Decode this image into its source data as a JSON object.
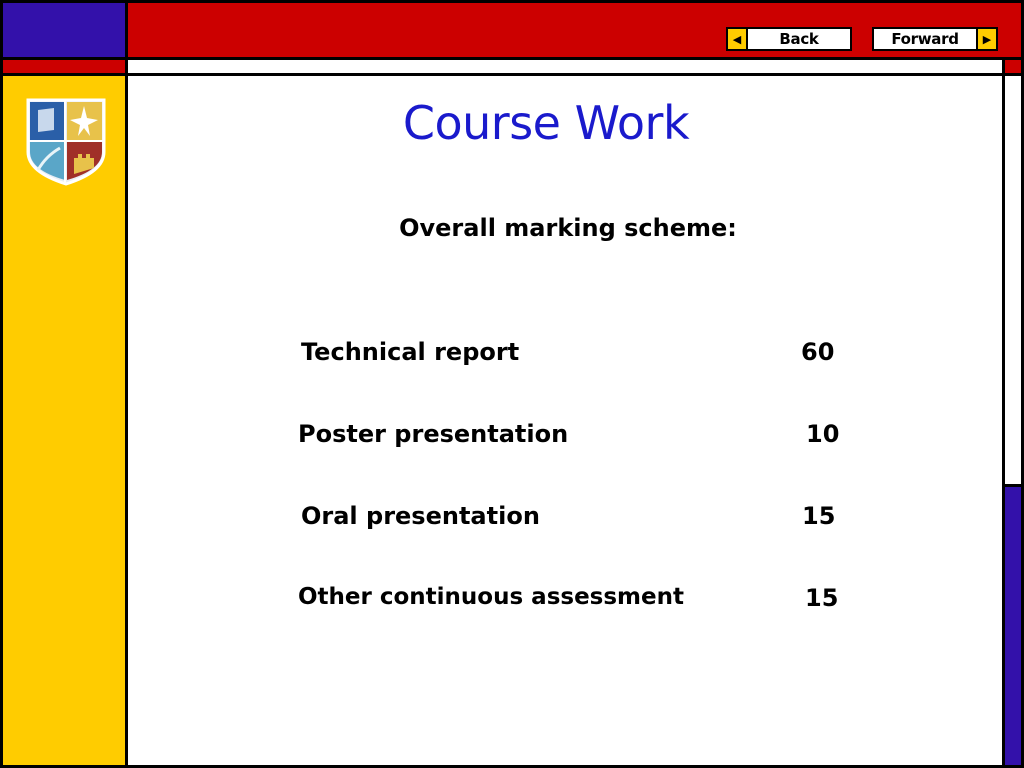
{
  "nav": {
    "back_label": "Back",
    "forward_label": "Forward",
    "back_arrow": "◀",
    "forward_arrow": "▶"
  },
  "slide": {
    "title": "Course Work",
    "subtitle": "Overall marking scheme:"
  },
  "marking_scheme": [
    {
      "item": "Technical report",
      "marks": "60"
    },
    {
      "item": "Poster presentation",
      "marks": "10"
    },
    {
      "item": "Oral presentation",
      "marks": "15"
    },
    {
      "item": "Other continuous assessment",
      "marks": "15"
    }
  ],
  "colors": {
    "blue": "#3311aa",
    "red": "#cc0000",
    "yellow": "#ffcc00",
    "title_blue": "#1a1acc"
  },
  "icons": {
    "crest": "university-crest-icon"
  }
}
